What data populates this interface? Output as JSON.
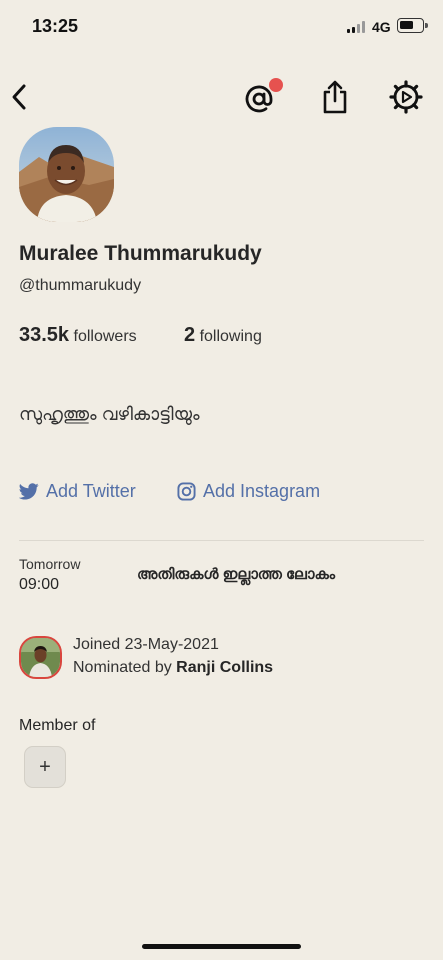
{
  "status_bar": {
    "time": "13:25",
    "network": "4G",
    "battery_level": 0.55
  },
  "nav": {
    "icons": [
      "back-chevron",
      "mention-at",
      "share",
      "settings-gear"
    ],
    "mention_has_badge": true
  },
  "profile": {
    "name": "Muralee Thummarukudy",
    "handle": "@thummarukudy",
    "followers_count": "33.5k",
    "followers_label": "followers",
    "following_count": "2",
    "following_label": "following",
    "bio": "സുഹൃത്തും വഴികാട്ടിയും"
  },
  "social": {
    "twitter_label": "Add Twitter",
    "instagram_label": "Add Instagram"
  },
  "event": {
    "day": "Tomorrow",
    "time": "09:00",
    "title": "അതിരുകൾ ഇല്ലാത്ത ലോകം"
  },
  "joined": {
    "text": "Joined 23-May-2021",
    "nominated_prefix": "Nominated by",
    "nominated_by": "Ranji Collins"
  },
  "clubs": {
    "heading": "Member of",
    "add_label": "+"
  },
  "colors": {
    "background": "#f1ede4",
    "link": "#5470a8",
    "badge": "#e6524f",
    "nominator_ring": "#d9463e"
  }
}
